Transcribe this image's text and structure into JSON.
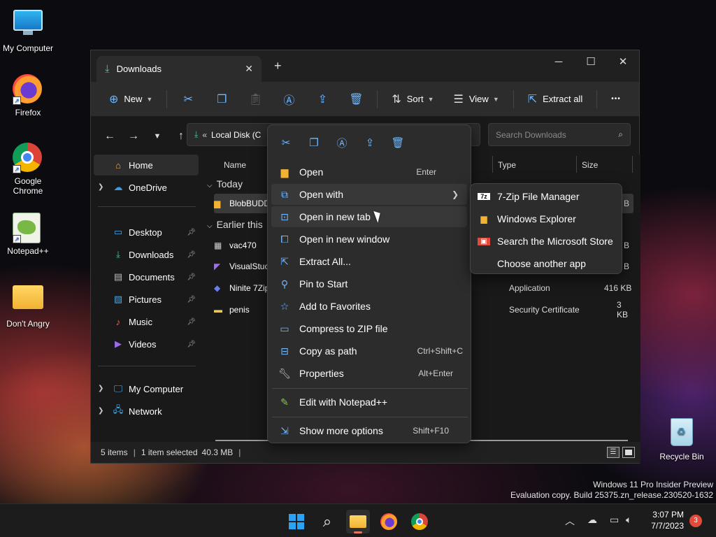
{
  "desktop": {
    "icons": [
      {
        "label": "My Computer",
        "icon": "monitor-icon"
      },
      {
        "label": "Firefox",
        "icon": "firefox-icon"
      },
      {
        "label": "Google Chrome",
        "icon": "chrome-icon"
      },
      {
        "label": "Notepad++",
        "icon": "notepadpp-icon"
      },
      {
        "label": "Don't Angry",
        "icon": "folder-icon"
      },
      {
        "label": "Recycle Bin",
        "icon": "recycle-bin-icon"
      }
    ],
    "watermark_line1": "Windows 11 Pro Insider Preview",
    "watermark_line2": "Evaluation copy. Build 25375.zn_release.230520-1632"
  },
  "window": {
    "tab_title": "Downloads",
    "toolbar": {
      "new_label": "New",
      "sort_label": "Sort",
      "view_label": "View",
      "extract_label": "Extract all",
      "more_label": "•••"
    },
    "address": {
      "chevrons": "«",
      "path": "Local Disk (C"
    },
    "search": {
      "placeholder": "Search Downloads"
    },
    "nav": {
      "home": "Home",
      "onedrive": "OneDrive",
      "desktop": "Desktop",
      "downloads": "Downloads",
      "documents": "Documents",
      "pictures": "Pictures",
      "music": "Music",
      "videos": "Videos",
      "mycomputer": "My Computer",
      "network": "Network"
    },
    "columns": {
      "name": "Name",
      "type": "Type",
      "size": "Size"
    },
    "groups": {
      "today": "Today",
      "earlier": "Earlier this"
    },
    "files": [
      {
        "name": "BlobBUDD",
        "type": "",
        "size": "B"
      },
      {
        "name": "vac470",
        "type": "",
        "size": "B"
      },
      {
        "name": "VisualStuc",
        "type": "",
        "size": "B"
      },
      {
        "name": "Ninite 7Zip",
        "type": "Application",
        "size": "416 KB"
      },
      {
        "name": "penis",
        "type": "Security Certificate",
        "size": "3 KB"
      }
    ],
    "status": {
      "items": "5 items",
      "selected": "1 item selected",
      "size": "40.3 MB"
    }
  },
  "context_menu": {
    "open": {
      "label": "Open",
      "shortcut": "Enter"
    },
    "open_with": {
      "label": "Open with"
    },
    "open_new_tab": {
      "label": "Open in new tab"
    },
    "open_new_window": {
      "label": "Open in new window"
    },
    "extract_all": {
      "label": "Extract All..."
    },
    "pin_start": {
      "label": "Pin to Start"
    },
    "favorites": {
      "label": "Add to Favorites"
    },
    "compress": {
      "label": "Compress to ZIP file"
    },
    "copy_path": {
      "label": "Copy as path",
      "shortcut": "Ctrl+Shift+C"
    },
    "properties": {
      "label": "Properties",
      "shortcut": "Alt+Enter"
    },
    "notepadpp": {
      "label": "Edit with Notepad++"
    },
    "more_options": {
      "label": "Show more options",
      "shortcut": "Shift+F10"
    }
  },
  "submenu": {
    "sevenzip": "7-Zip File Manager",
    "explorer": "Windows Explorer",
    "store": "Search the Microsoft Store",
    "another": "Choose another app"
  },
  "taskbar": {
    "time": "3:07 PM",
    "date": "7/7/2023",
    "notifications": "3"
  },
  "colors": {
    "accent": "#6fb8ff",
    "folder": "#f2b233",
    "badge": "#e24a3b"
  }
}
